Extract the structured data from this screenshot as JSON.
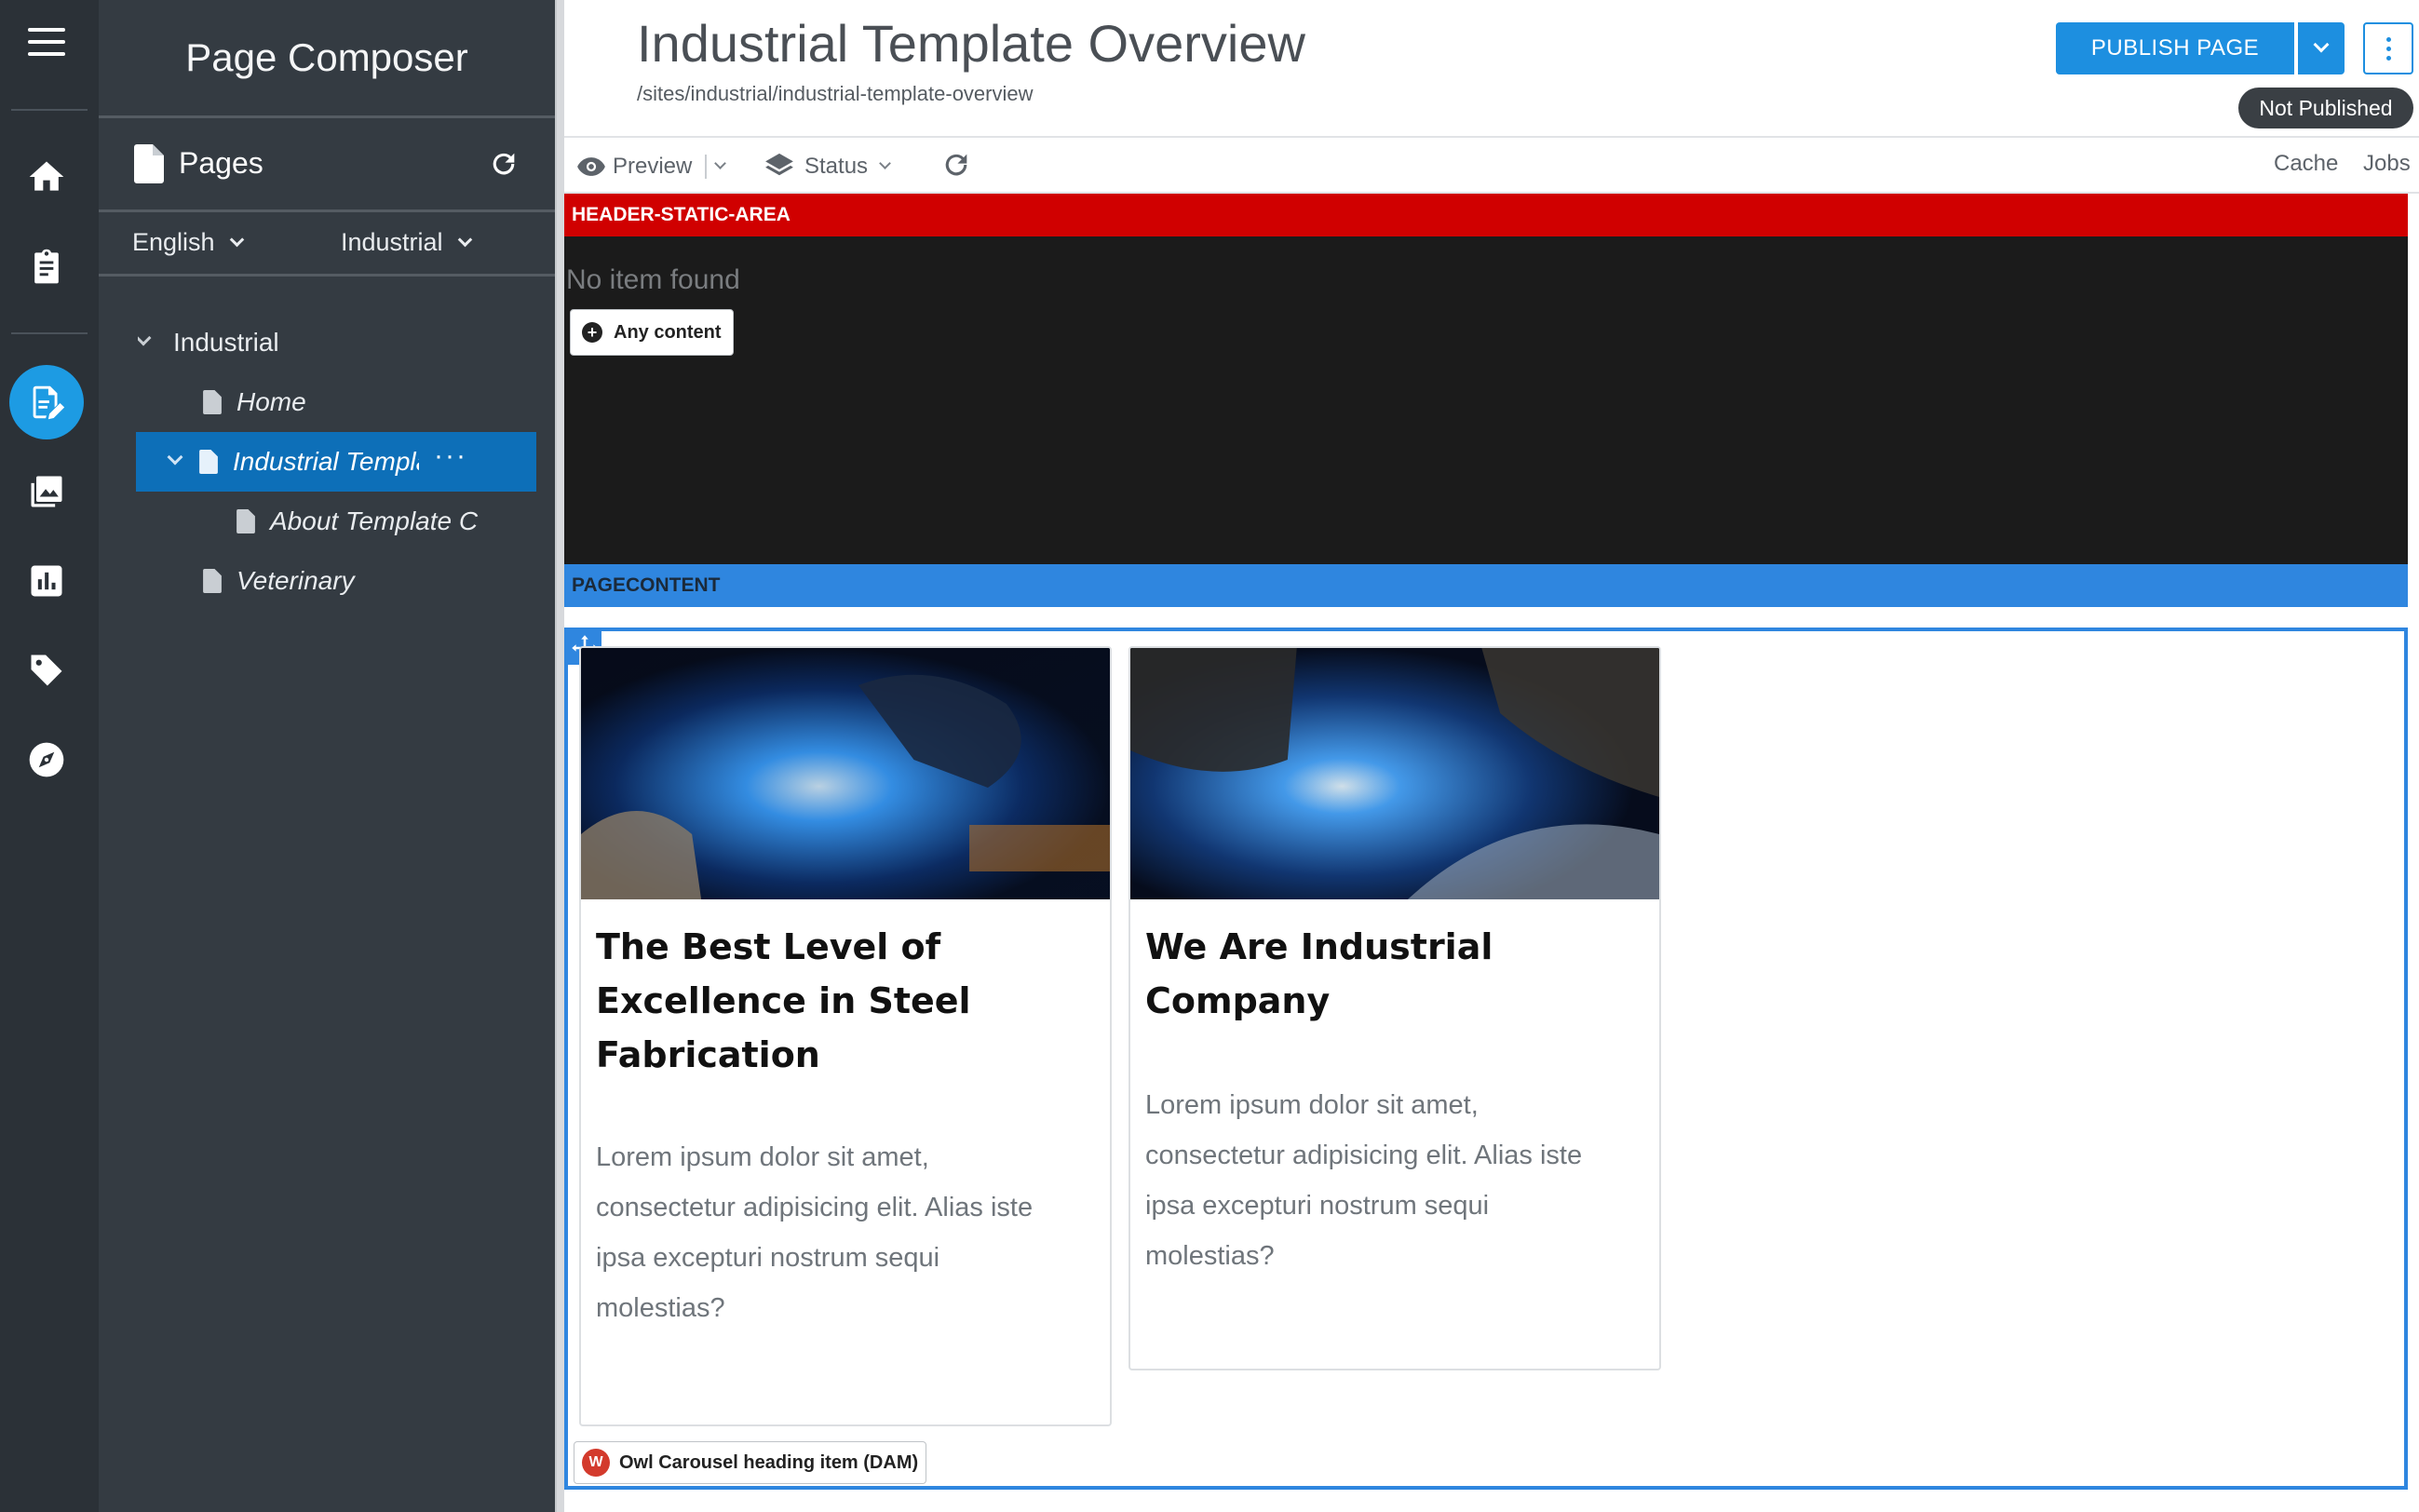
{
  "sidebar": {
    "title": "Page Composer",
    "pages_label": "Pages",
    "language": "English",
    "site": "Industrial",
    "tree": [
      {
        "label": "Industrial"
      },
      {
        "label": "Home"
      },
      {
        "label": "Industrial Templá",
        "menu": "···"
      },
      {
        "label": "About Template C"
      },
      {
        "label": "Veterinary"
      }
    ]
  },
  "header": {
    "title": "Industrial Template Overview",
    "path": "/sites/industrial/industrial-template-overview",
    "publish_label": "PUBLISH PAGE",
    "status_badge": "Not Published"
  },
  "toolbar": {
    "preview": "Preview",
    "status": "Status",
    "cache": "Cache",
    "jobs": "Jobs"
  },
  "canvas": {
    "header_area": "HEADER-STATIC-AREA",
    "no_item": "No item found",
    "any_content": "Any content",
    "page_content": "PAGECONTENT",
    "cards": [
      {
        "title": "The Best Level of Excellence in Steel Fabrication",
        "text": "Lorem ipsum dolor sit amet, consectetur adipisicing elit. Alias iste ipsa excepturi nostrum sequi molestias?"
      },
      {
        "title": "We Are Industrial Company",
        "text": "Lorem ipsum dolor sit amet, consectetur adipisicing elit. Alias iste ipsa excepturi nostrum sequi molestias?"
      }
    ],
    "carousel_item": "Owl Carousel heading item (DAM)"
  },
  "colors": {
    "rail": "#2b3137",
    "sidebar": "#343b42",
    "accent": "#1d8fe0",
    "selected": "#0d6fb8",
    "header_strip": "#d00000",
    "content_strip": "#2f86df"
  },
  "icons": [
    "menu-icon",
    "home-icon",
    "clipboard-icon",
    "page-edit-icon",
    "images-icon",
    "chart-icon",
    "tag-icon",
    "compass-icon",
    "file-icon",
    "refresh-icon",
    "eye-icon",
    "layers-icon",
    "plus-circle-icon",
    "move-icon"
  ]
}
